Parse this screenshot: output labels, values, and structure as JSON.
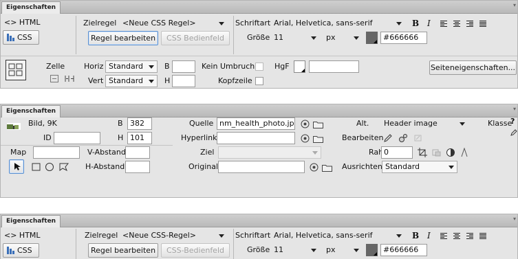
{
  "panel_tab": "Eigenschaften",
  "panel_menu_glyph": "▾",
  "p1": {
    "html_mode": "<> HTML",
    "css_mode": "CSS",
    "target_rule_label": "Zielregel",
    "target_rule_value": "<Neue CSS Regel>",
    "edit_rule": "Regel bearbeiten",
    "css_panel": "CSS Bedienfeld",
    "font_label": "Schriftart",
    "font_value": "Arial, Helvetica, sans-serif",
    "bold": "B",
    "italic": "I",
    "size_label": "Größe",
    "size_value": "11",
    "unit_value": "px",
    "color_value": "#666666",
    "color_hex": "#666666",
    "cell_label": "Zelle",
    "horz_label": "Horiz",
    "horz_value": "Standard",
    "vert_label": "Vert",
    "vert_value": "Standard",
    "w_label": "B",
    "h_label": "H",
    "nowrap_label": "Kein Umbruch",
    "header_label": "Kopfzeile",
    "bg_label": "HgF",
    "page_props": "Seiteneigenschaften..."
  },
  "p2": {
    "image_label": "Bild, 9K",
    "id_label": "ID",
    "w_label": "B",
    "w_value": "382",
    "h_label": "H",
    "h_value": "101",
    "src_label": "Quelle",
    "src_value": "nm_health_photo.jpg",
    "link_label": "Hyperlink",
    "target_label": "Ziel",
    "original_label": "Original",
    "alt_label": "Alt.",
    "alt_value": "Header image",
    "class_label": "Klasse",
    "edit_label": "Bearbeiten",
    "border_label": "Rahmen",
    "border_value": "0",
    "align_label": "Ausrichten",
    "align_value": "Standard",
    "map_label": "Map",
    "vspace_label": "V-Abstand",
    "hspace_label": "H-Abstand",
    "help_glyph": "?"
  },
  "p3": {
    "html_mode": "<> HTML",
    "css_mode": "CSS",
    "target_rule_label": "Zielregel",
    "target_rule_value": "<Neue CSS-Regel>",
    "edit_rule": "Regel bearbeiten",
    "css_panel": "CSS-Bedienfeld",
    "font_label": "Schriftart",
    "font_value": "Arial, Helvetica, sans-serif",
    "bold": "B",
    "italic": "I",
    "size_label": "Größe",
    "size_value": "11",
    "unit_value": "px",
    "color_value": "#666666",
    "color_hex": "#666666"
  },
  "colors": {
    "panel_bg": "#e5e5e5",
    "focus_blue": "#5a8fd0",
    "swatch": "#666666"
  }
}
